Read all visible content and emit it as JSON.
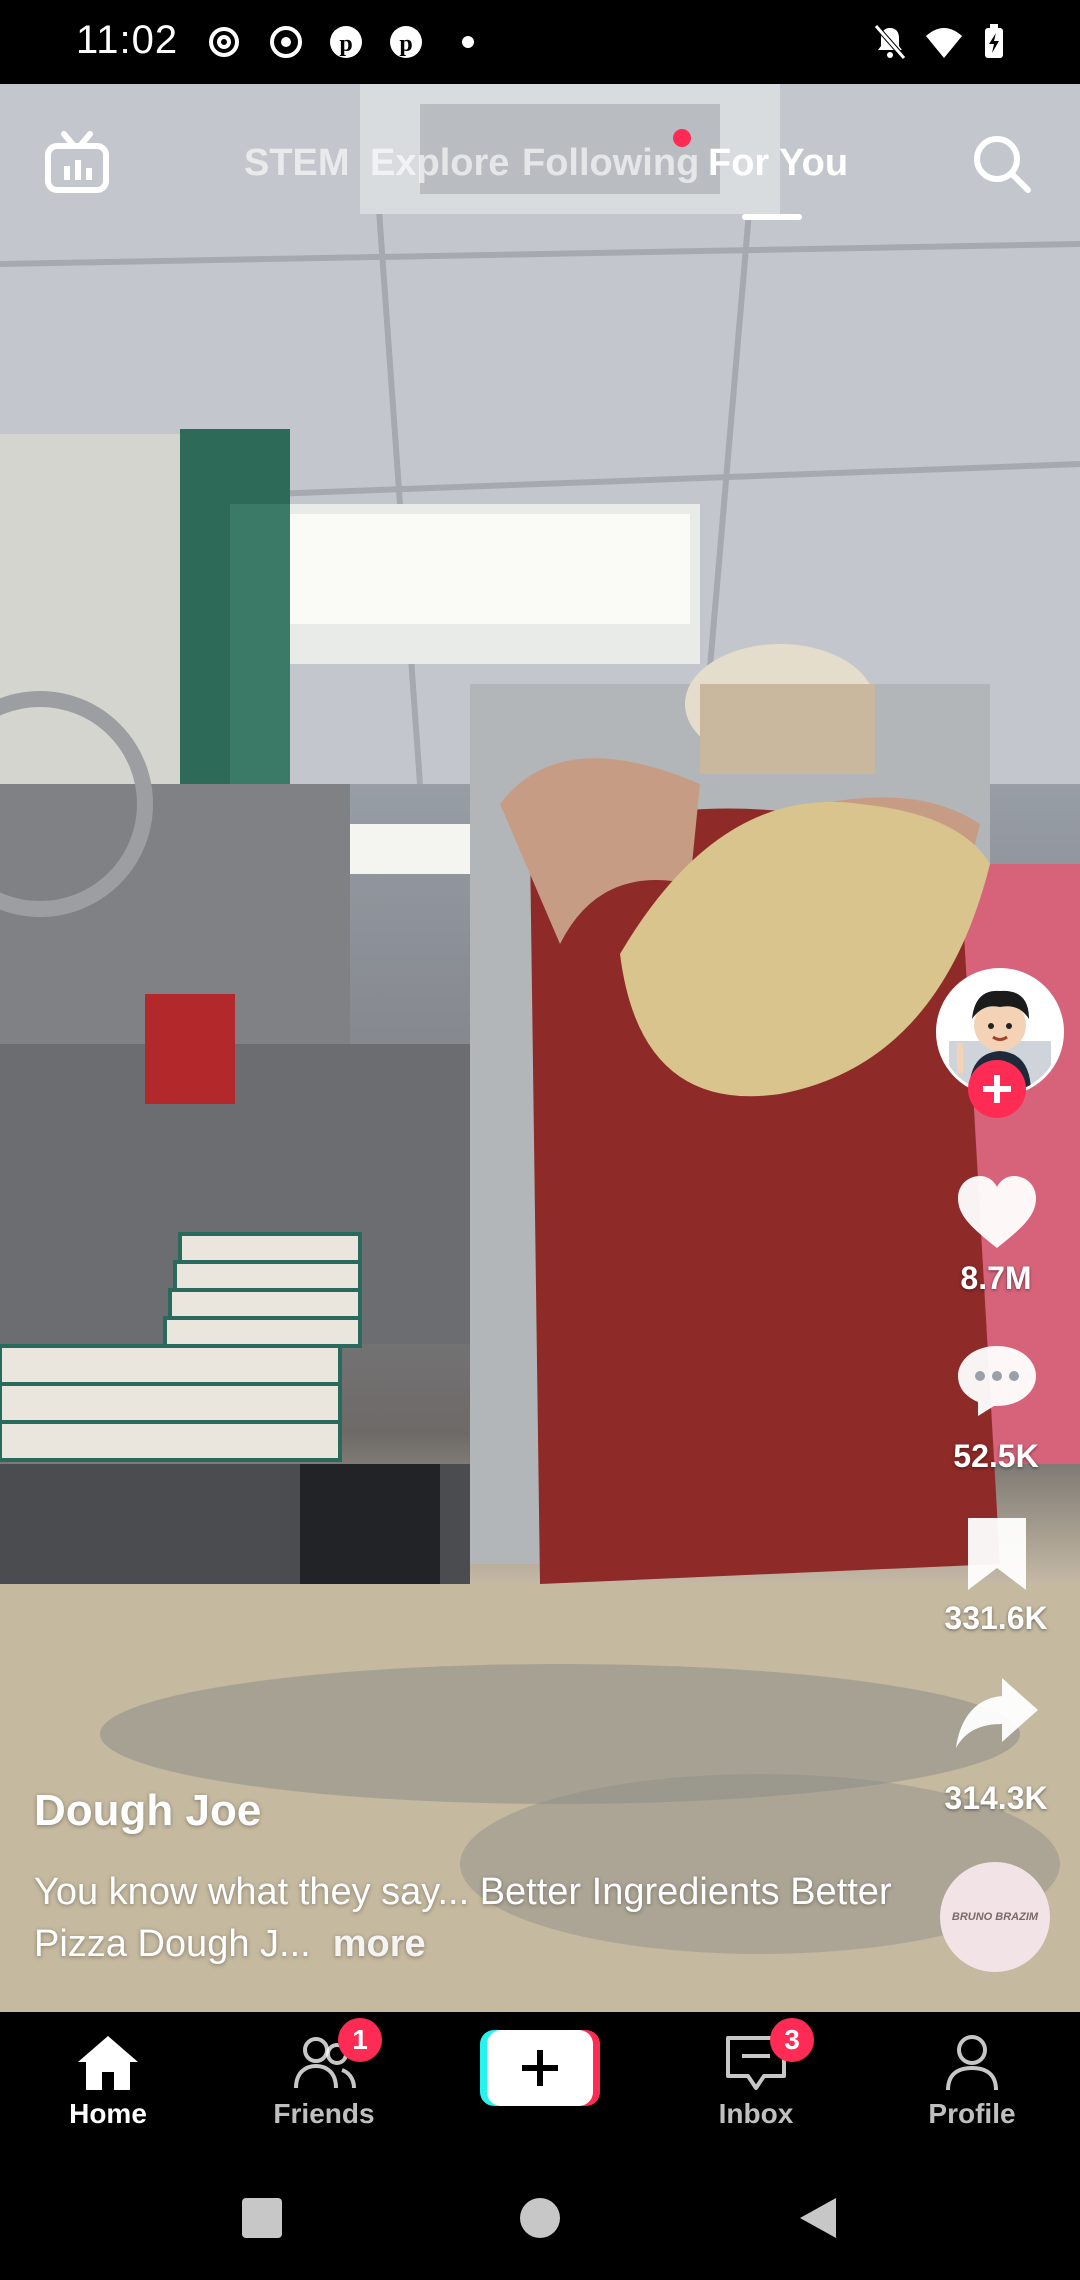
{
  "status_bar": {
    "time": "11:02",
    "left_icons": [
      "threads-icon",
      "circle-record-icon",
      "pinterest-icon",
      "pinterest-icon",
      "dot-icon"
    ],
    "right_icons": [
      "mute-icon",
      "wifi-icon",
      "battery-charging-icon"
    ]
  },
  "top_tabs": {
    "items": [
      "STEM",
      "Explore",
      "Following",
      "For You"
    ],
    "active": "For You",
    "live_icon": "tv-icon",
    "search_icon": "search-icon"
  },
  "right_rail": {
    "avatar_icon": "creator-avatar",
    "follow_icon": "plus-icon",
    "likes": "8.7M",
    "comments": "52.5K",
    "saves": "331.6K",
    "shares": "314.3K",
    "music_disc_text": "BRUNO BRAZIM"
  },
  "video": {
    "author": "Dough Joe",
    "caption": "You know what they say... Better Ingredients Better Pizza Dough J...",
    "more": "more"
  },
  "bottom_nav": {
    "home": "Home",
    "friends": "Friends",
    "friends_badge": "1",
    "inbox": "Inbox",
    "inbox_badge": "3",
    "profile": "Profile"
  },
  "colors": {
    "accent": "#fe2c55",
    "create_left": "#25f4ee",
    "create_right": "#fe2c55"
  }
}
